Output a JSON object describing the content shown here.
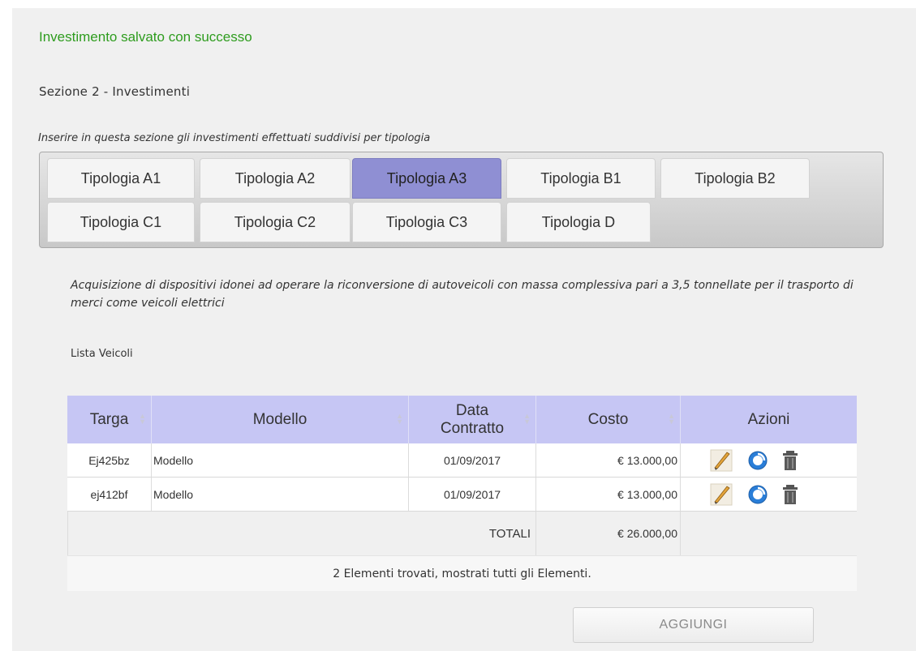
{
  "messages": {
    "success": "Investimento salvato con successo"
  },
  "section": {
    "title": "Sezione 2 - Investimenti",
    "description": "Inserire in questa sezione gli investimenti effettuati suddivisi per tipologia"
  },
  "tabs": [
    {
      "label": "Tipologia A1",
      "active": false
    },
    {
      "label": "Tipologia A2",
      "active": false
    },
    {
      "label": "Tipologia A3",
      "active": true
    },
    {
      "label": "Tipologia B1",
      "active": false
    },
    {
      "label": "Tipologia B2",
      "active": false
    },
    {
      "label": "Tipologia C1",
      "active": false
    },
    {
      "label": "Tipologia C2",
      "active": false
    },
    {
      "label": "Tipologia C3",
      "active": false
    },
    {
      "label": "Tipologia D",
      "active": false
    }
  ],
  "investment": {
    "description": "Acquisizione di dispositivi idonei ad operare la riconversione di autoveicoli con massa complessiva pari a 3,5 tonnellate per il trasporto di merci come veicoli elettrici"
  },
  "list": {
    "title": "Lista Veicoli",
    "columns": [
      "Targa",
      "Modello",
      "Data Contratto",
      "Costo",
      "Azioni"
    ],
    "rows": [
      {
        "targa": "Ej425bz",
        "modello": "Modello",
        "data": "01/09/2017",
        "costo": "€ 13.000,00"
      },
      {
        "targa": "ej412bf",
        "modello": "Modello",
        "data": "01/09/2017",
        "costo": "€ 13.000,00"
      }
    ],
    "totals_label": "TOTALI",
    "totals_value": "€ 26.000,00",
    "footer": "2 Elementi trovati, mostrati tutti gli Elementi.",
    "row_actions": [
      "pencil-icon",
      "refresh-icon",
      "trash-icon"
    ]
  },
  "buttons": {
    "add": "AGGIUNGI"
  },
  "colors": {
    "success": "#2e9c1e",
    "active_tab": "#8f8fd3",
    "table_header": "#c6c6f4"
  }
}
